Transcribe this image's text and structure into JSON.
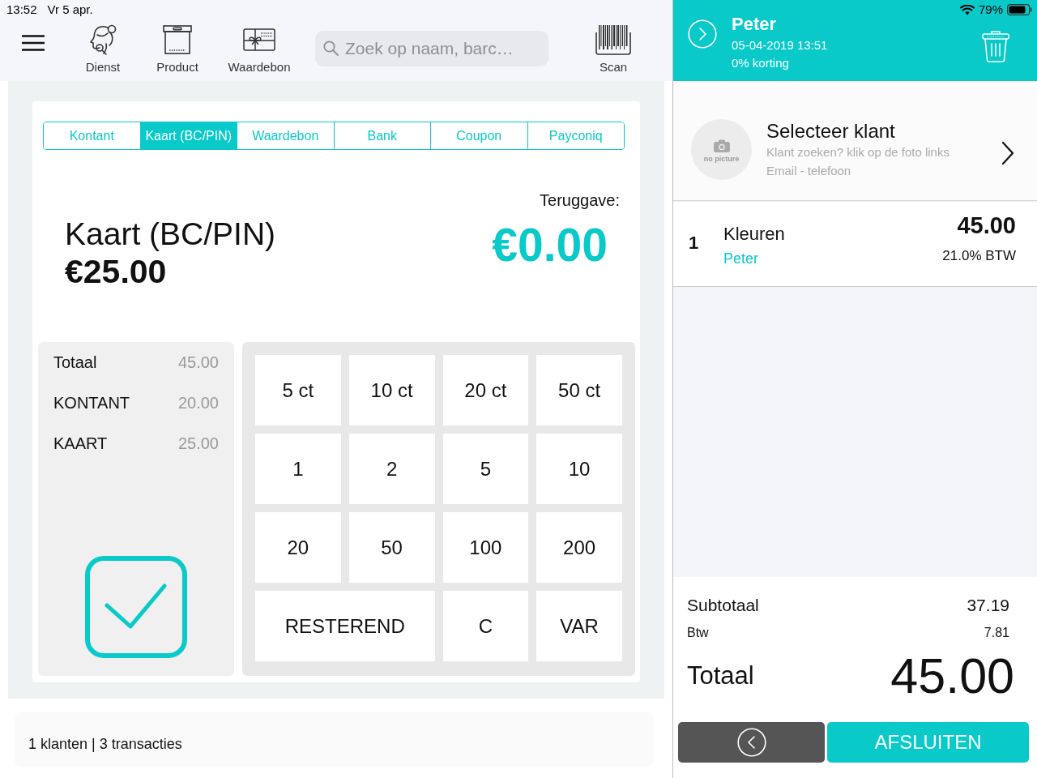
{
  "status_bar": {
    "time": "13:52",
    "date": "Vr 5 apr.",
    "battery": "79%"
  },
  "toolbar": {
    "items": [
      {
        "label": "Dienst",
        "kind": "service"
      },
      {
        "label": "Product",
        "kind": "product"
      },
      {
        "label": "Waardebon",
        "kind": "voucher"
      }
    ],
    "search": {
      "placeholder": "Zoek op naam, barc…"
    },
    "scan": {
      "label": "Scan"
    }
  },
  "payment": {
    "tabs": [
      {
        "label": "Kontant",
        "selected": false
      },
      {
        "label": "Kaart (BC/PIN)",
        "selected": true
      },
      {
        "label": "Waardebon",
        "selected": false
      },
      {
        "label": "Bank",
        "selected": false
      },
      {
        "label": "Coupon",
        "selected": false
      },
      {
        "label": "Payconiq",
        "selected": false
      }
    ],
    "method": "Kaart (BC/PIN)",
    "amount": "€25.00",
    "change_label": "Teruggave:",
    "change": "€0.00",
    "summary": [
      {
        "label": "Totaal",
        "value": "45.00"
      },
      {
        "label": "KONTANT",
        "value": "20.00"
      },
      {
        "label": "KAART",
        "value": "25.00"
      }
    ],
    "keypad": [
      {
        "label": "5 ct",
        "kind": "key"
      },
      {
        "label": "10 ct",
        "kind": "key"
      },
      {
        "label": "20 ct",
        "kind": "key"
      },
      {
        "label": "50 ct",
        "kind": "key"
      },
      {
        "label": "1",
        "kind": "key"
      },
      {
        "label": "2",
        "kind": "key"
      },
      {
        "label": "5",
        "kind": "key"
      },
      {
        "label": "10",
        "kind": "key"
      },
      {
        "label": "20",
        "kind": "key"
      },
      {
        "label": "50",
        "kind": "key"
      },
      {
        "label": "100",
        "kind": "key"
      },
      {
        "label": "200",
        "kind": "key"
      },
      {
        "label": "RESTEREND",
        "kind": "wide"
      },
      {
        "label": "C",
        "kind": "key"
      },
      {
        "label": "VAR",
        "kind": "key"
      }
    ]
  },
  "footer": {
    "stats": "1 klanten | 3 transacties"
  },
  "receipt": {
    "header": {
      "title": "Peter",
      "datetime": "05-04-2019 13:51",
      "discount": "0% korting"
    },
    "customer": {
      "avatar_label": "no picture",
      "title": "Selecteer klant",
      "hint": "Klant zoeken? klik op de foto links",
      "contact": "Email - telefoon"
    },
    "lines": [
      {
        "qty": "1",
        "name": "Kleuren",
        "employee": "Peter",
        "price": "45.00",
        "vat": "21.0% BTW"
      }
    ],
    "totals": {
      "subtotal_label": "Subtotaal",
      "subtotal": "37.19",
      "vat_label": "Btw",
      "vat": "7.81",
      "total_label": "Totaal",
      "total": "45.00"
    },
    "close_button": "AFSLUITEN"
  }
}
